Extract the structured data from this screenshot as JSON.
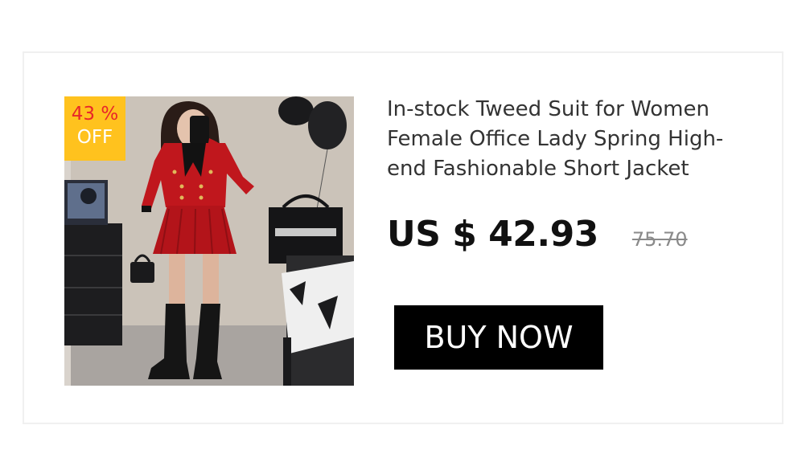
{
  "product": {
    "title": "In-stock Tweed Suit for Women Female Office Lady Spring High-end Fashionable Short Jacket",
    "current_price": "US $ 42.93",
    "original_price": "75.70",
    "image_alt": "Woman in red tweed jacket and pleated mini skirt with black knee-high boots"
  },
  "badge": {
    "percent": "43 %",
    "off": "OFF"
  },
  "actions": {
    "buy_label": "BUY NOW"
  },
  "colors": {
    "badge_bg": "#ffc21e",
    "badge_percent": "#e8262a",
    "button_bg": "#000000",
    "jacket": "#c0171d"
  }
}
